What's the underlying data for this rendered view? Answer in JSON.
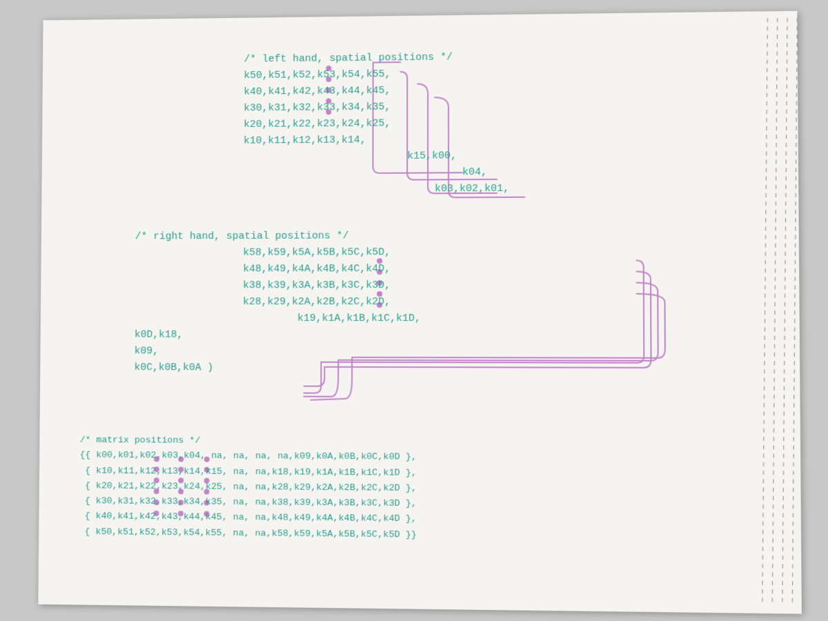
{
  "page": {
    "background": "#f5f4f0"
  },
  "left_hand": {
    "comment": "/* left hand, spatial positions */",
    "rows": [
      "k50,k51,k52,k53,k54,k55,",
      "k40,k41,k42,k43,k44,k45,",
      "k30,k31,k32,k33,k34,k35,",
      "k20,k21,k22,k23,k24,k25,",
      "k10,k11,k12,k13,k14,",
      "k15,k00,",
      "k04,",
      "k03,k02,k01,"
    ]
  },
  "right_hand": {
    "comment": "/* right hand, spatial positions */",
    "rows": [
      "k58,k59,k5A,k5B,k5C,k5D,",
      "k48,k49,k4A,k4B,k4C,k4D,",
      "k38,k39,k3A,k3B,k3C,k3D,",
      "k28,k29,k2A,k2B,k2C,k2D,",
      "k19,k1A,k1B,k1C,k1D,",
      "k0D,k18,",
      "k09,",
      "k0C,k0B,k0A )"
    ]
  },
  "matrix": {
    "comment": "/* matrix positions */",
    "rows": [
      "{{ k00,k01,k02,k03,k04,  na,  na,     na, na,k09,k0A,k0B,k0C,k0D },",
      " { k10,k11,k12,k13,k14,k15,  na,     na,k18,k19,k1A,k1B,k1C,k1D },",
      " { k20,k21,k22,k23,k24,k25,  na,     na,k28,k29,k2A,k2B,k2C,k2D },",
      " { k30,k31,k32,k33,k34,k35,  na,     na,k38,k39,k3A,k3B,k3C,k3D },",
      " { k40,k41,k42,k43,k44,k45,  na,     na,k48,k49,k4A,k4B,k4C,k4D },",
      " { k50,k51,k52,k53,k54,k55,  na,     na,k58,k59,k5A,k5B,k5C,k5D }}"
    ]
  }
}
